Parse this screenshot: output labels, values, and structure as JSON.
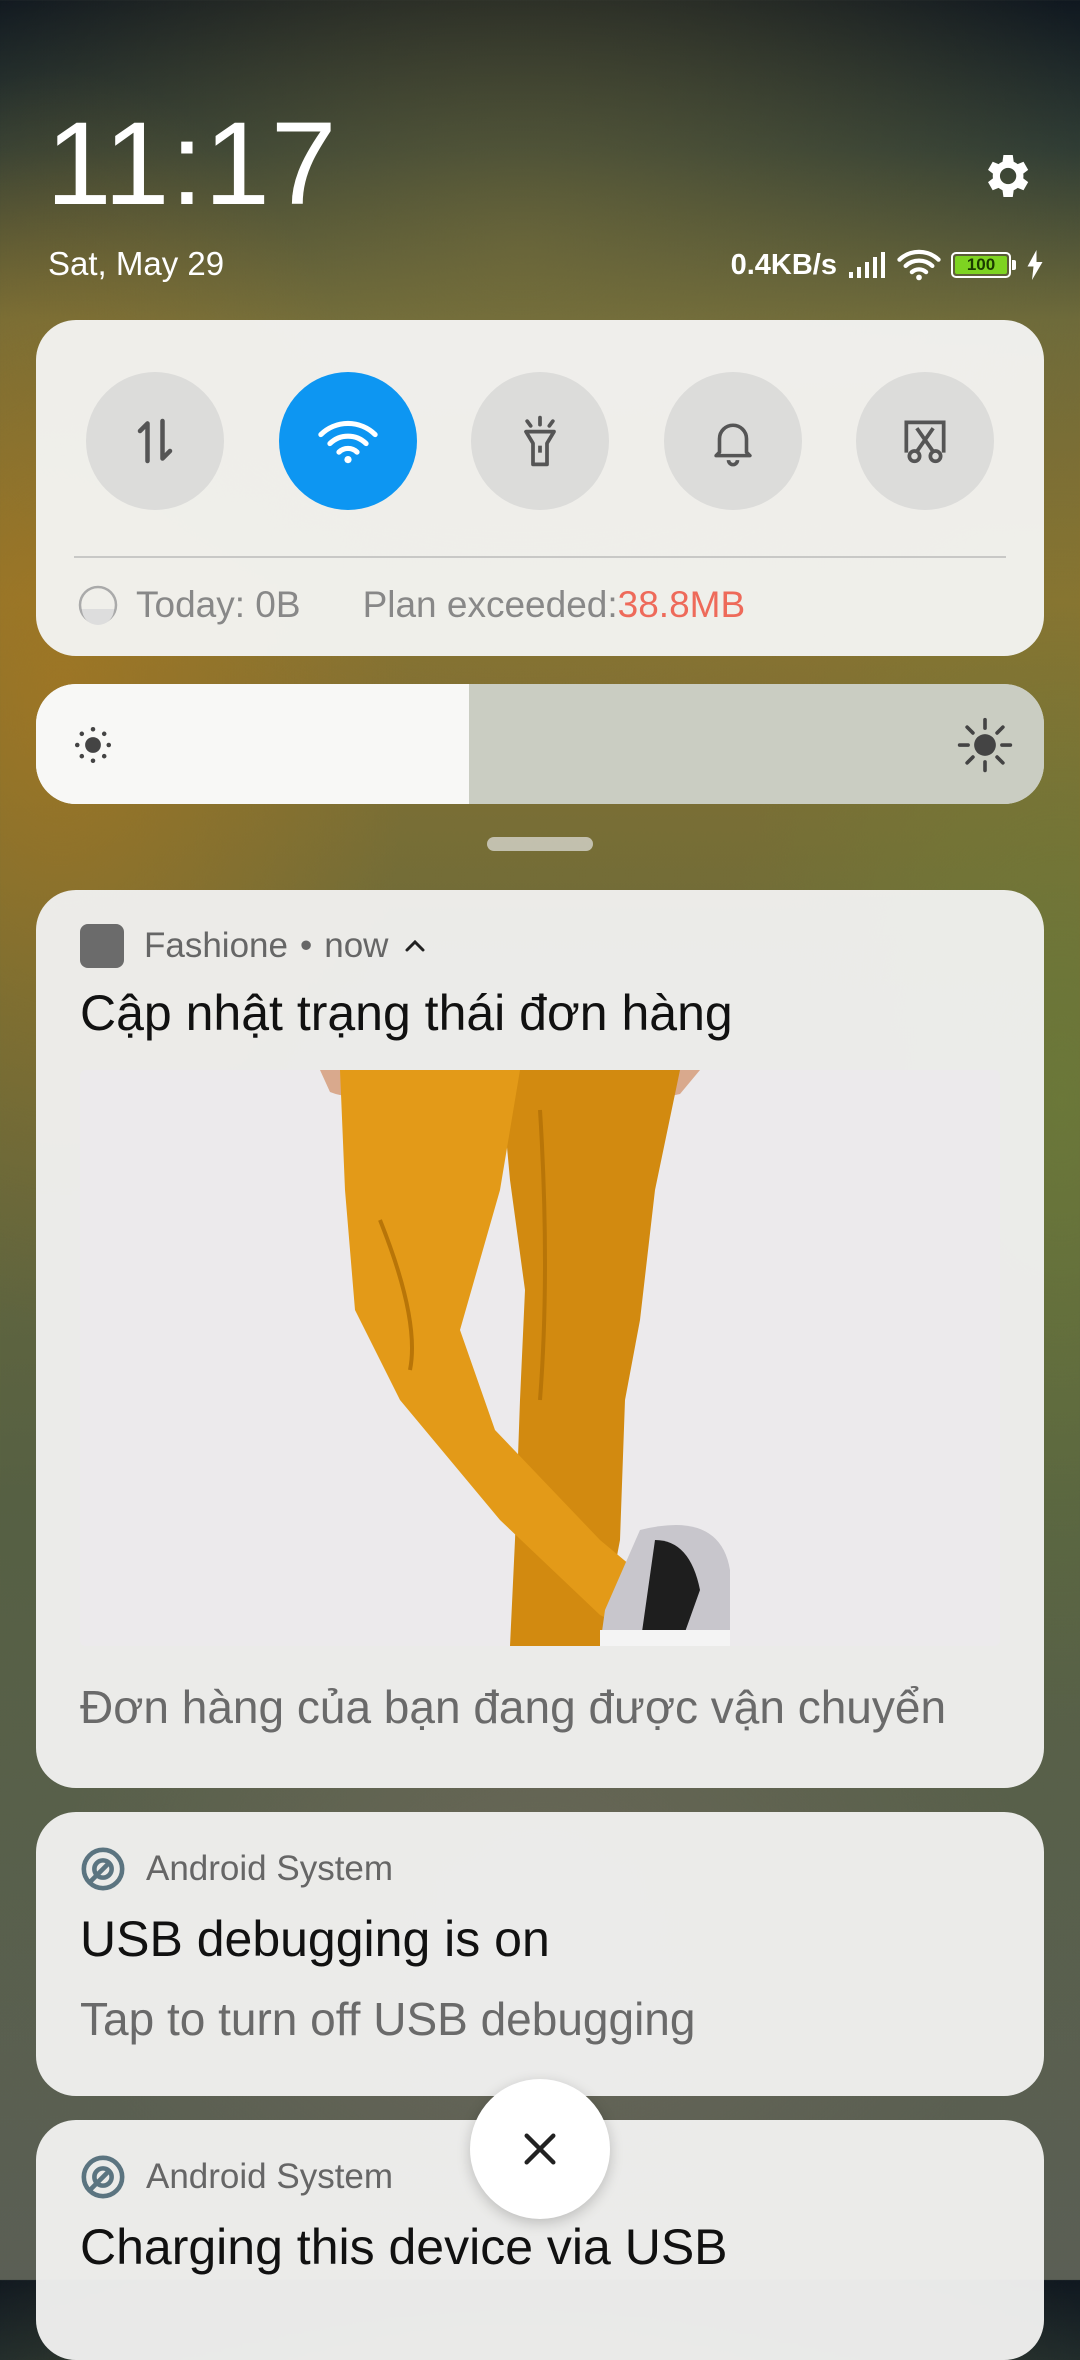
{
  "header": {
    "time": "11:17",
    "date": "Sat, May 29",
    "net_speed": "0.4KB/s",
    "battery": "100"
  },
  "quick_settings": {
    "toggles": [
      {
        "name": "mobile-data-toggle",
        "icon": "data-arrows-icon",
        "active": false
      },
      {
        "name": "wifi-toggle",
        "icon": "wifi-icon",
        "active": true
      },
      {
        "name": "flashlight-toggle",
        "icon": "flashlight-icon",
        "active": false
      },
      {
        "name": "sound-toggle",
        "icon": "bell-icon",
        "active": false
      },
      {
        "name": "screenshot-toggle",
        "icon": "scissors-icon",
        "active": false
      }
    ],
    "usage_today": "Today: 0B",
    "plan_label": "Plan exceeded: ",
    "plan_value": "38.8MB",
    "accent": "#0d96f2",
    "warning_color": "#ee6a5a"
  },
  "brightness": {
    "level": 0.43
  },
  "notifications": [
    {
      "app": "Fashione",
      "time": "now",
      "title": "Cập nhật trạng thái đơn hàng",
      "body": "Đơn hàng của bạn đang được vận chuyển"
    },
    {
      "app": "Android System",
      "title": "USB debugging is on",
      "body": "Tap to turn off USB debugging"
    },
    {
      "app": "Android System",
      "title": "Charging this device via USB"
    }
  ],
  "sep": "•"
}
